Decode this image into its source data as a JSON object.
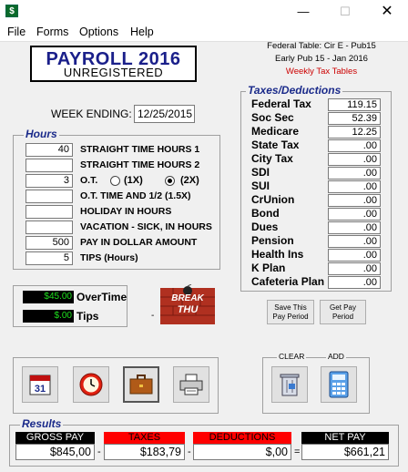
{
  "menu": [
    "File",
    "Forms",
    "Options",
    "Help"
  ],
  "logo": {
    "line1": "PAYROLL 2016",
    "line2": "UNREGISTERED"
  },
  "header": {
    "federal_table": "Federal Table: Cir E - Pub15",
    "early_pub": "Early Pub 15 - Jan 2016",
    "tax_tables": "Weekly Tax Tables"
  },
  "colors": {
    "tax_tables": "#cc0000",
    "group_title": "#1a2a8a",
    "lcd_green": "#1ee01e",
    "taxes_header": "#ff0000"
  },
  "week_ending": {
    "label": "WEEK ENDING:",
    "value": "12/25/2015"
  },
  "hours": {
    "title": "Hours",
    "rows": [
      {
        "value": "40",
        "label": "STRAIGHT TIME HOURS 1"
      },
      {
        "value": "",
        "label": "STRAIGHT TIME HOURS 2"
      },
      {
        "value": "3",
        "label": "O.T."
      },
      {
        "value": "",
        "label": "O.T. TIME AND 1/2 (1.5X)"
      },
      {
        "value": "",
        "label": "HOLIDAY IN HOURS"
      },
      {
        "value": "",
        "label": "VACATION - SICK, IN HOURS"
      },
      {
        "value": "500",
        "label": "PAY IN DOLLAR AMOUNT"
      },
      {
        "value": "5",
        "label": "TIPS (Hours)"
      }
    ],
    "ot_option_1x": "(1X)",
    "ot_option_2x": "(2X)"
  },
  "taxes": {
    "title": "Taxes/Deductions",
    "rows": [
      {
        "label": "Federal Tax",
        "value": "119.15"
      },
      {
        "label": "Soc Sec",
        "value": "52.39"
      },
      {
        "label": "Medicare",
        "value": "12.25"
      },
      {
        "label": "State Tax",
        "value": ".00"
      },
      {
        "label": "City Tax",
        "value": ".00"
      },
      {
        "label": "SDI",
        "value": ".00"
      },
      {
        "label": "SUI",
        "value": ".00"
      },
      {
        "label": "CrUnion",
        "value": ".00"
      },
      {
        "label": "Bond",
        "value": ".00"
      },
      {
        "label": "Dues",
        "value": ".00"
      },
      {
        "label": "Pension",
        "value": ".00"
      },
      {
        "label": "Health Ins",
        "value": ".00"
      },
      {
        "label": "K Plan",
        "value": ".00"
      },
      {
        "label": "Cafeteria Plan",
        "value": ".00"
      }
    ]
  },
  "overtime": {
    "value": "$45.00",
    "label": "OverTime"
  },
  "tips": {
    "value": "$.00",
    "label": "Tips"
  },
  "break_logo": {
    "line1": "BREAK",
    "line2": "THU"
  },
  "save_button": {
    "line1": "Save This",
    "line2": "Pay Period"
  },
  "get_button": {
    "line1": "Get Pay",
    "line2": "Period"
  },
  "clear_label": "CLEAR",
  "add_label": "ADD",
  "calendar_day": "31",
  "results": {
    "title": "Results",
    "gross": {
      "label": "GROSS PAY",
      "value": "$845,00"
    },
    "taxes": {
      "label": "TAXES",
      "value": "$183,79"
    },
    "deductions": {
      "label": "DEDUCTIONS",
      "value": "$,00"
    },
    "net": {
      "label": "NET PAY",
      "value": "$661,21"
    },
    "op_minus1": "-",
    "op_minus2": "-",
    "op_equals": "="
  }
}
